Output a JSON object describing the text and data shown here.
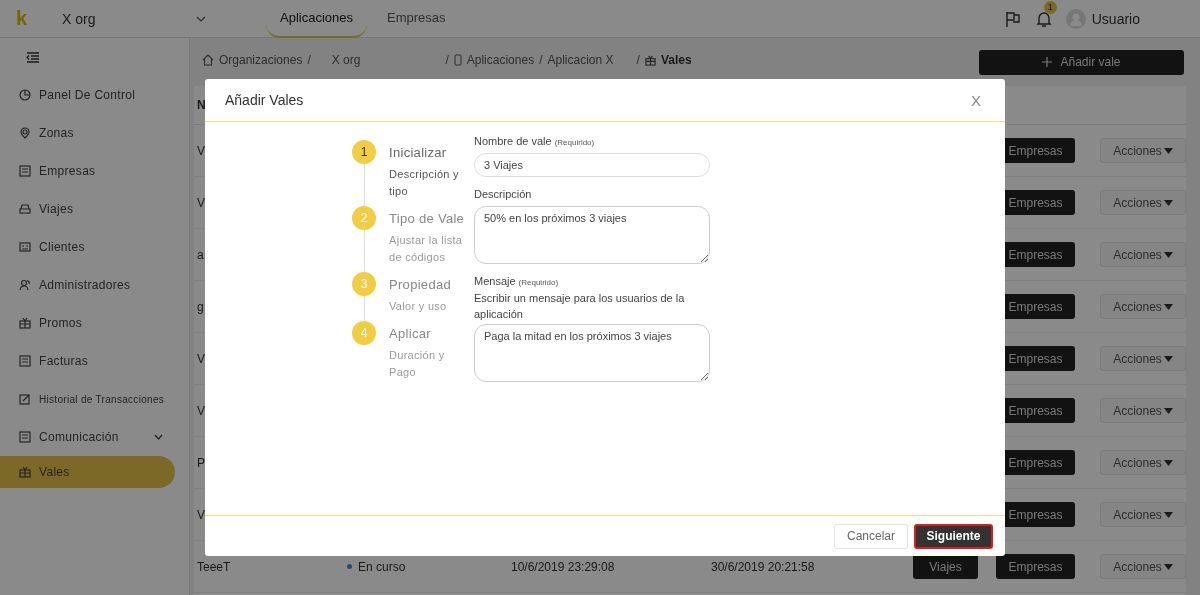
{
  "topbar": {
    "logo": "k",
    "org": "X org",
    "tabs": [
      {
        "label": "Aplicaciones",
        "selected": true
      },
      {
        "label": "Empresas",
        "selected": false
      }
    ],
    "notification_count": "1",
    "user": "Usuario"
  },
  "sidebar": {
    "items": [
      {
        "label": "Panel De Control",
        "selected": false,
        "small": false
      },
      {
        "label": "Zonas",
        "selected": false,
        "small": false
      },
      {
        "label": "Empresas",
        "selected": false,
        "small": false
      },
      {
        "label": "Viajes",
        "selected": false,
        "small": false
      },
      {
        "label": "Clientes",
        "selected": false,
        "small": false
      },
      {
        "label": "Administradores",
        "selected": false,
        "small": false
      },
      {
        "label": "Promos",
        "selected": false,
        "small": false
      },
      {
        "label": "Facturas",
        "selected": false,
        "small": false
      },
      {
        "label": "Historial de Transacciones",
        "selected": false,
        "small": true
      },
      {
        "label": "Comunicación",
        "selected": false,
        "small": false,
        "expanded": false
      },
      {
        "label": "Vales",
        "selected": true,
        "small": false
      }
    ]
  },
  "breadcrumb": [
    "Organizaciones",
    "X org",
    "Aplicaciones",
    "Aplicacion X",
    "Vales"
  ],
  "breadcrumb_separator": "/",
  "add_button": "Añadir vale",
  "table": {
    "header_visible": "N",
    "rows": [
      {
        "name": "V",
        "buttons": [
          "Empresas",
          "Acciones"
        ]
      },
      {
        "name": "V",
        "buttons": [
          "Empresas",
          "Acciones"
        ]
      },
      {
        "name": "a",
        "buttons": [
          "Empresas",
          "Acciones"
        ]
      },
      {
        "name": "g",
        "buttons": [
          "Empresas",
          "Acciones"
        ]
      },
      {
        "name": "V",
        "buttons": [
          "Empresas",
          "Acciones"
        ]
      },
      {
        "name": "V",
        "buttons": [
          "Empresas",
          "Acciones"
        ]
      },
      {
        "name": "P",
        "buttons": [
          "Empresas",
          "Acciones"
        ]
      },
      {
        "name": "V",
        "buttons": [
          "Empresas",
          "Acciones"
        ]
      },
      {
        "name": "TeeeT",
        "status": "En curso",
        "color": "#1f4a8a",
        "start": "10/6/2019 23:29:08",
        "end": "30/6/2019 20:21:58",
        "trips_button": "Viajes",
        "buttons": [
          "Empresas",
          "Acciones"
        ]
      }
    ]
  },
  "modal": {
    "title": "Añadir Vales",
    "close": "X",
    "steps": [
      {
        "number": "1",
        "title": "Inicializar",
        "subtitle": "Descripción y tipo",
        "selected": true
      },
      {
        "number": "2",
        "title": "Tipo de Vale",
        "subtitle": "Ajustar la lista de códigos",
        "selected": false
      },
      {
        "number": "3",
        "title": "Propiedad",
        "subtitle": "Valor y uso",
        "selected": false
      },
      {
        "number": "4",
        "title": "Aplicar",
        "subtitle": "Duración y Pago",
        "selected": false
      }
    ],
    "fields": [
      {
        "kind": "input",
        "label": "Nombre de vale",
        "note": "(Requirido)",
        "value": "3 Viajes"
      },
      {
        "kind": "textarea",
        "label": "Descripción",
        "value": "50% en los próximos 3 viajes"
      },
      {
        "kind": "textarea",
        "label": "Mensaje",
        "note": "(Requirido)",
        "help": "Escribir un mensaje para los usuarios de la aplicación",
        "value": "Paga la mitad en los próximos 3 viajes"
      }
    ],
    "buttons": {
      "cancel": "Cancelar",
      "next": "Siguiente"
    }
  }
}
